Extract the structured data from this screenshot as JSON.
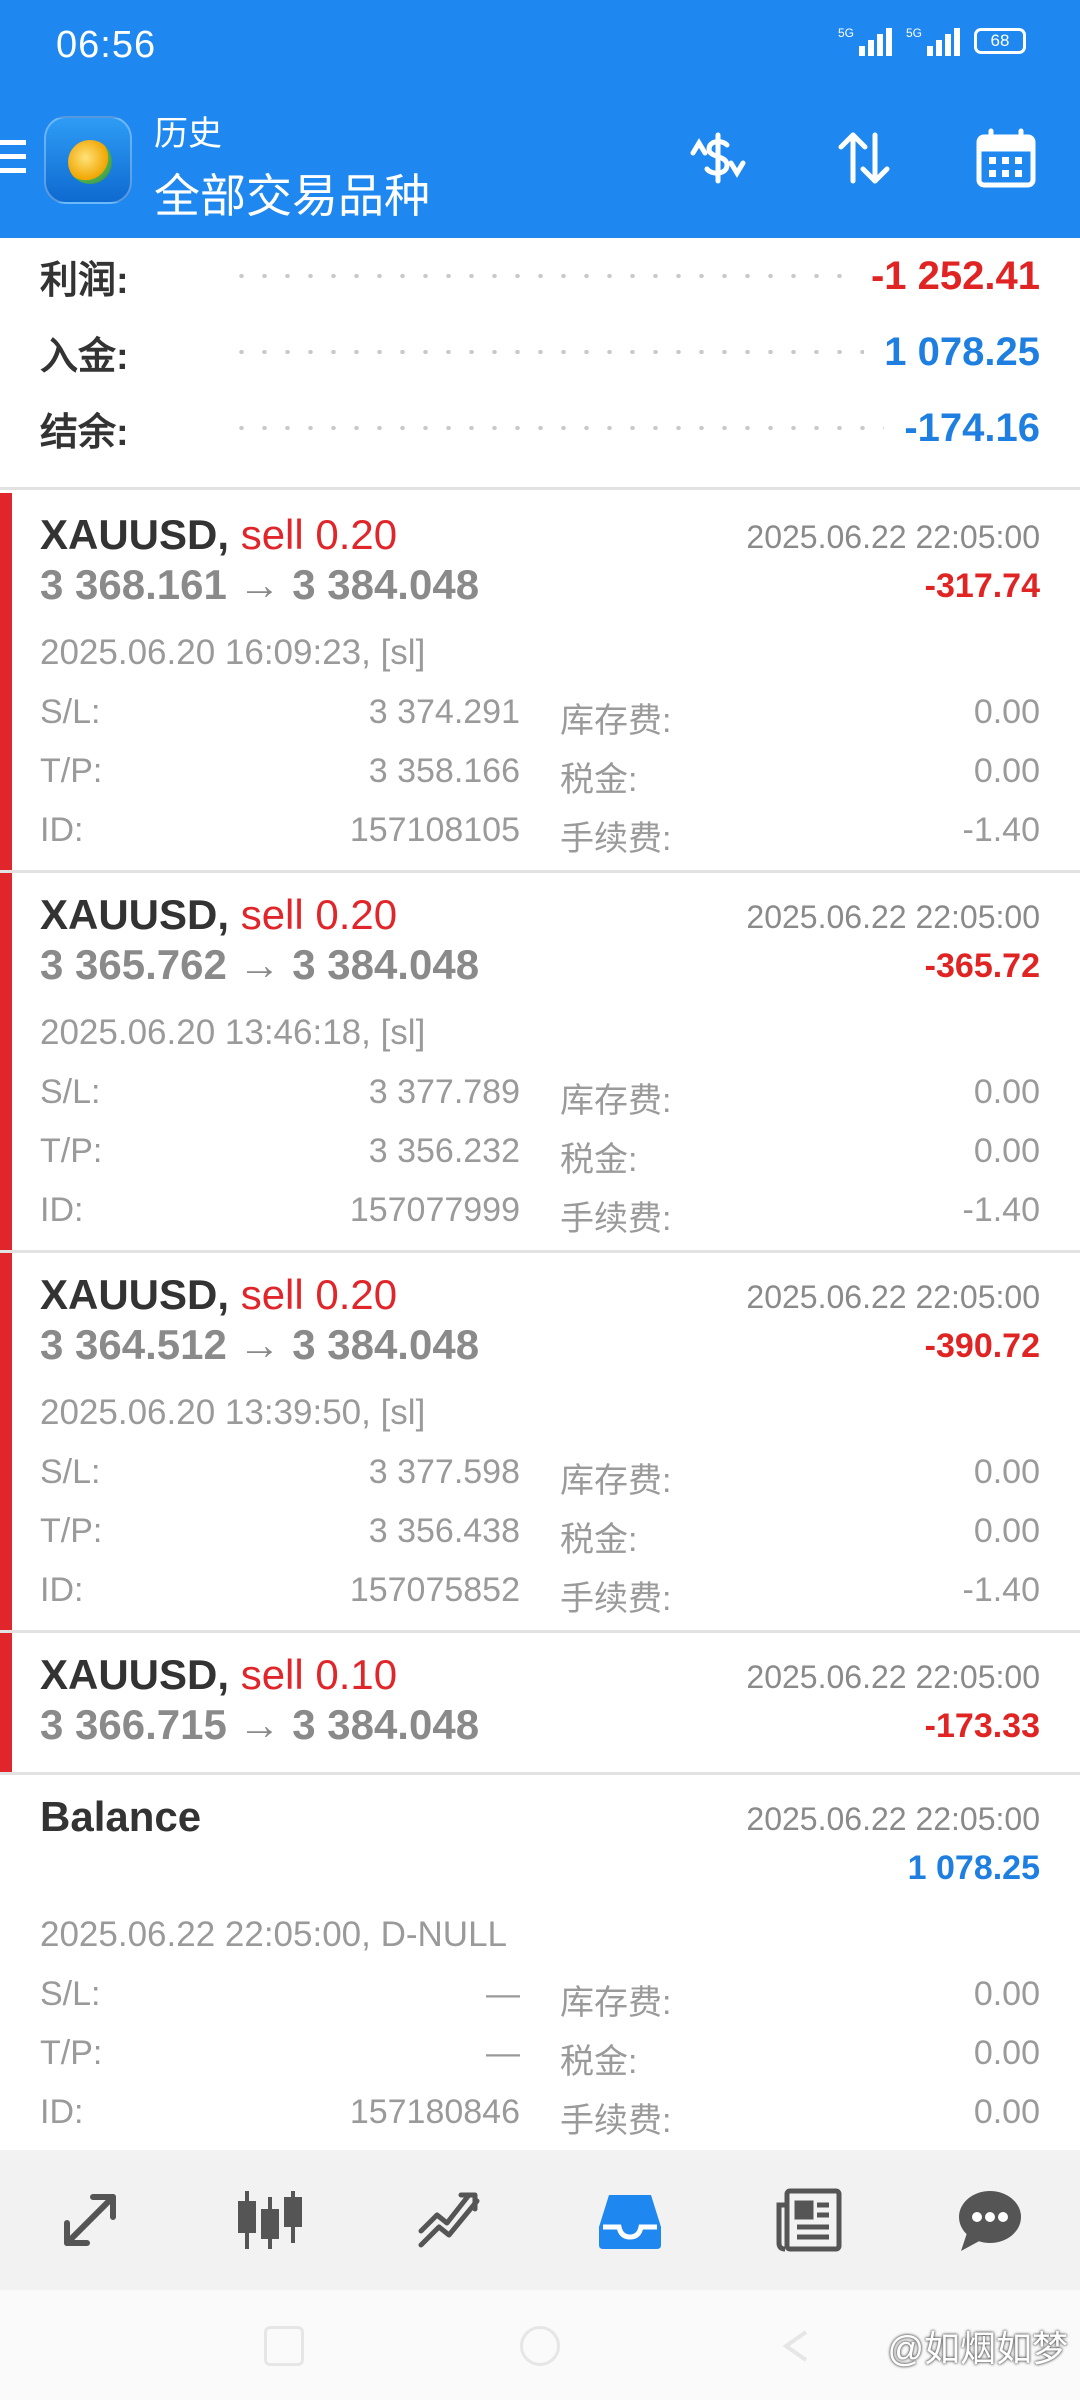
{
  "status_bar": {
    "time": "06:56",
    "signal_1": "5G",
    "signal_2": "5G",
    "battery": "68"
  },
  "header": {
    "subtitle": "历史",
    "title": "全部交易品种",
    "icons": [
      "menu-icon",
      "currency-exchange-icon",
      "sort-icon",
      "calendar-icon"
    ]
  },
  "summary": {
    "profit_label": "利润:",
    "profit_value": "-1 252.41",
    "deposit_label": "入金:",
    "deposit_value": "1 078.25",
    "balance_label": "结余:",
    "balance_value": "-174.16"
  },
  "labels": {
    "sl": "S/L:",
    "tp": "T/P:",
    "id": "ID:",
    "swap": "库存费:",
    "tax": "税金:",
    "commission": "手续费:"
  },
  "deals": [
    {
      "symbol": "XAUUSD,",
      "side": "sell 0.20",
      "open_price": "3 368.161",
      "arrow": "→",
      "close_price": "3 384.048",
      "close_time": "2025.06.22 22:05:00",
      "profit": "-317.74",
      "open_info": "2025.06.20 16:09:23, [sl]",
      "sl": "3 374.291",
      "tp": "3 358.166",
      "id": "157108105",
      "swap": "0.00",
      "tax": "0.00",
      "commission": "-1.40"
    },
    {
      "symbol": "XAUUSD,",
      "side": "sell 0.20",
      "open_price": "3 365.762",
      "arrow": "→",
      "close_price": "3 384.048",
      "close_time": "2025.06.22 22:05:00",
      "profit": "-365.72",
      "open_info": "2025.06.20 13:46:18, [sl]",
      "sl": "3 377.789",
      "tp": "3 356.232",
      "id": "157077999",
      "swap": "0.00",
      "tax": "0.00",
      "commission": "-1.40"
    },
    {
      "symbol": "XAUUSD,",
      "side": "sell 0.20",
      "open_price": "3 364.512",
      "arrow": "→",
      "close_price": "3 384.048",
      "close_time": "2025.06.22 22:05:00",
      "profit": "-390.72",
      "open_info": "2025.06.20 13:39:50, [sl]",
      "sl": "3 377.598",
      "tp": "3 356.438",
      "id": "157075852",
      "swap": "0.00",
      "tax": "0.00",
      "commission": "-1.40"
    },
    {
      "symbol": "XAUUSD,",
      "side": "sell 0.10",
      "open_price": "3 366.715",
      "arrow": "→",
      "close_price": "3 384.048",
      "close_time": "2025.06.22 22:05:00",
      "profit": "-173.33"
    }
  ],
  "balance_entry": {
    "title": "Balance",
    "close_time": "2025.06.22 22:05:00",
    "amount": "1 078.25",
    "info": "2025.06.22 22:05:00, D-NULL",
    "sl": "—",
    "tp": "—",
    "id": "157180846",
    "swap": "0.00",
    "tax": "0.00",
    "commission": "0.00"
  },
  "bottom_nav": [
    "quotes-icon",
    "chart-icon",
    "trade-icon",
    "history-icon",
    "news-icon",
    "chat-icon"
  ],
  "watermark": "@如烟如梦",
  "colors": {
    "header": "#1e88f0",
    "loss": "#e0262a",
    "gain": "#1e7fe0",
    "active_tab": "#1e88f0"
  }
}
